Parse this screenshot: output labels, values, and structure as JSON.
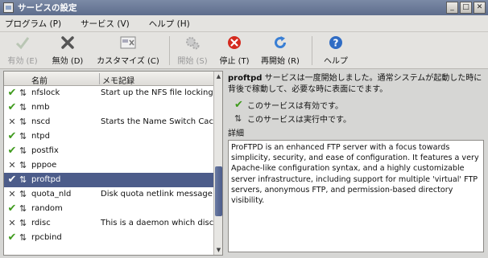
{
  "window": {
    "title": "サービスの設定",
    "controls": [
      "_",
      "□",
      "✕"
    ]
  },
  "menubar": [
    {
      "label": "プログラム (P)"
    },
    {
      "label": "サービス (V)"
    },
    {
      "label": "ヘルプ (H)"
    }
  ],
  "toolbar": {
    "enable": {
      "label": "有効 (E)",
      "icon": "check-icon"
    },
    "disable": {
      "label": "無効 (D)",
      "icon": "x-icon"
    },
    "customize": {
      "label": "カスタマイズ (C)",
      "icon": "customize-icon"
    },
    "start": {
      "label": "開始 (S)",
      "icon": "gears-icon"
    },
    "stop": {
      "label": "停止 (T)",
      "icon": "stop-icon"
    },
    "restart": {
      "label": "再開始 (R)",
      "icon": "refresh-icon"
    },
    "help": {
      "label": "ヘルプ",
      "icon": "help-icon"
    }
  },
  "services_list": {
    "columns": [
      "名前",
      "メモ記録"
    ],
    "rows": [
      {
        "enabled": true,
        "name": "nfslock",
        "description": "Start up the NFS file locking s"
      },
      {
        "enabled": true,
        "name": "nmb",
        "description": ""
      },
      {
        "enabled": false,
        "name": "nscd",
        "description": "Starts the Name Switch Cache"
      },
      {
        "enabled": true,
        "name": "ntpd",
        "description": ""
      },
      {
        "enabled": true,
        "name": "postfix",
        "description": ""
      },
      {
        "enabled": false,
        "name": "pppoe",
        "description": ""
      },
      {
        "enabled": true,
        "name": "proftpd",
        "description": "",
        "selected": true
      },
      {
        "enabled": false,
        "name": "quota_nld",
        "description": "Disk quota netlink message da"
      },
      {
        "enabled": true,
        "name": "random",
        "description": ""
      },
      {
        "enabled": false,
        "name": "rdisc",
        "description": "This is a daemon which discove"
      },
      {
        "enabled": true,
        "name": "rpcbind",
        "description": ""
      }
    ]
  },
  "details": {
    "service_name": "proftpd",
    "message": " サービスは一度開始しました。通常システムが起動した時に背後で稼動して、必要な時に表面にでます。",
    "status_enabled": "このサービスは有効です。",
    "status_running": "このサービスは実行中です。",
    "details_label": "詳細",
    "description": "ProFTPD is an enhanced FTP server with a focus towards simplicity, security, and ease of configuration. It features a very Apache-like configuration syntax, and a highly customizable server infrastructure, including support for multiple 'virtual' FTP servers, anonymous FTP, and permission-based directory visibility."
  },
  "colors": {
    "selection": "#4c5c8a",
    "enabled_check": "#3e9a1c",
    "stop_red": "#d42a1e",
    "refresh_blue": "#3a7fd4",
    "help_blue": "#2f6cc4"
  }
}
